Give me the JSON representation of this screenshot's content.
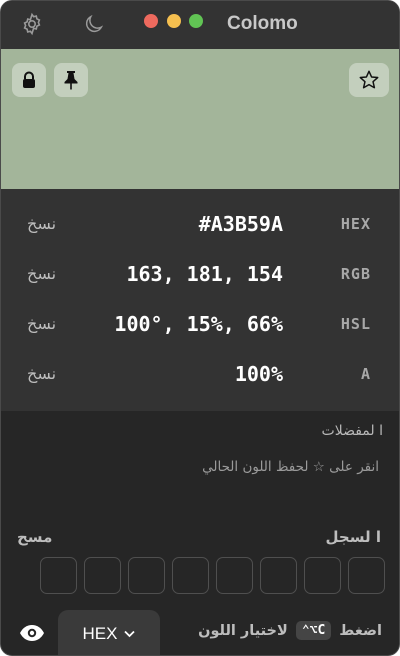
{
  "app": {
    "title": "Colomo"
  },
  "titlebar": {
    "settings_icon": "gear-icon",
    "theme_icon": "moon-icon",
    "traffic_lights": {
      "close": "#ee6a5e",
      "minimize": "#f5bf4f",
      "zoom": "#61c454"
    }
  },
  "color": {
    "swatch": "#A3B59A",
    "lock_icon": "lock-icon",
    "pin_icon": "pin-icon",
    "favorite_icon": "star-icon"
  },
  "values": {
    "hex": {
      "label": "HEX",
      "value": "#A3B59A",
      "copy": "نسخ"
    },
    "rgb": {
      "label": "RGB",
      "value": "163, 181, 154",
      "copy": "نسخ"
    },
    "hsl": {
      "label": "HSL",
      "value": "100°, 15%, 66%",
      "copy": "نسخ"
    },
    "alpha": {
      "label": "A",
      "value": "100%",
      "copy": "نسخ"
    }
  },
  "favorites": {
    "title": "ا لمفضلات",
    "hint_before": "انقر على",
    "hint_icon": "☆",
    "hint_after": "لحفظ اللون الحالي"
  },
  "history": {
    "title": "ا لسجل",
    "clear_label": "مسح",
    "slots": 8
  },
  "bottom": {
    "eye_icon": "eye-icon",
    "format_value": "HEX",
    "format_chevron": "chevron-down-icon",
    "press_label": "اضغط",
    "shortcut": "⌃⌥C",
    "pick_label": "لاختيار اللون"
  }
}
